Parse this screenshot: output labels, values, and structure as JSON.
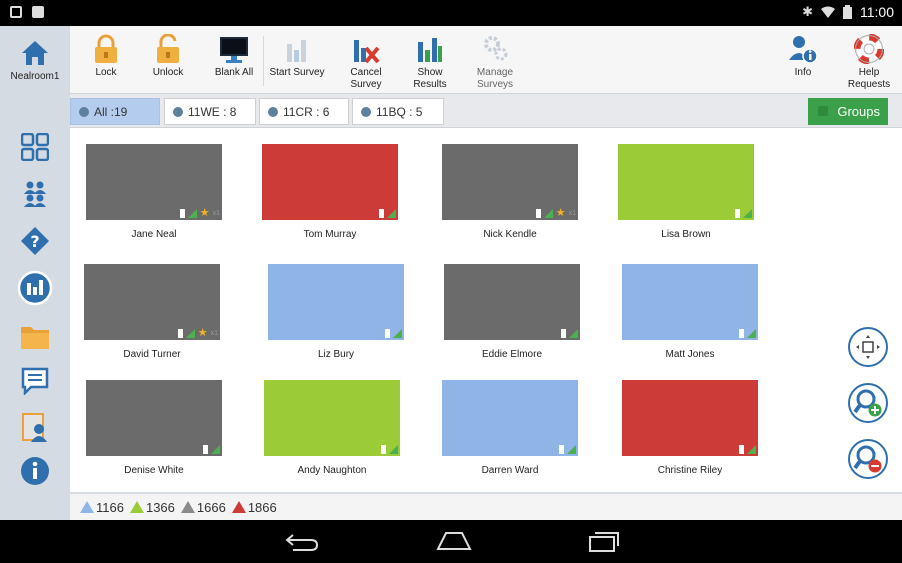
{
  "status": {
    "time": "11:00"
  },
  "home": {
    "label": "Nealroom1"
  },
  "toolbar": {
    "lock": "Lock",
    "unlock": "Unlock",
    "blank_all": "Blank All",
    "start_survey": "Start Survey",
    "cancel_survey_1": "Cancel",
    "cancel_survey_2": "Survey",
    "show_results_1": "Show",
    "show_results_2": "Results",
    "manage_surveys_1": "Manage",
    "manage_surveys_2": "Surveys",
    "info": "Info",
    "help_1": "Help",
    "help_2": "Requests"
  },
  "tabs": [
    {
      "label": "All :19"
    },
    {
      "label": "11WE : 8"
    },
    {
      "label": "11CR : 6"
    },
    {
      "label": "11BQ : 5"
    }
  ],
  "groups_label": "Groups",
  "students": [
    {
      "name": "Jane Neal",
      "color": "#6b6b6b",
      "star": true
    },
    {
      "name": "Tom Murray",
      "color": "#cc3b37",
      "star": false
    },
    {
      "name": "Nick Kendle",
      "color": "#6b6b6b",
      "star": true
    },
    {
      "name": "Lisa Brown",
      "color": "#9bcb36",
      "star": false
    },
    {
      "name": "David Turner",
      "color": "#6b6b6b",
      "star": true
    },
    {
      "name": "Liz Bury",
      "color": "#8fb4e6",
      "star": false
    },
    {
      "name": "Eddie Elmore",
      "color": "#6b6b6b",
      "star": false
    },
    {
      "name": "Matt Jones",
      "color": "#8fb4e6",
      "star": false
    },
    {
      "name": "Denise White",
      "color": "#6b6b6b",
      "star": false
    },
    {
      "name": "Andy Naughton",
      "color": "#9bcb36",
      "star": false
    },
    {
      "name": "Darren Ward",
      "color": "#8fb4e6",
      "star": false
    },
    {
      "name": "Christine Riley",
      "color": "#cc3b37",
      "star": false
    }
  ],
  "star_count": "x1",
  "versions": [
    {
      "label": "1166",
      "color": "#8fb4e6"
    },
    {
      "label": "1366",
      "color": "#9bcb36"
    },
    {
      "label": "1666",
      "color": "#8a8a8a"
    },
    {
      "label": "1866",
      "color": "#cc3b37"
    }
  ]
}
